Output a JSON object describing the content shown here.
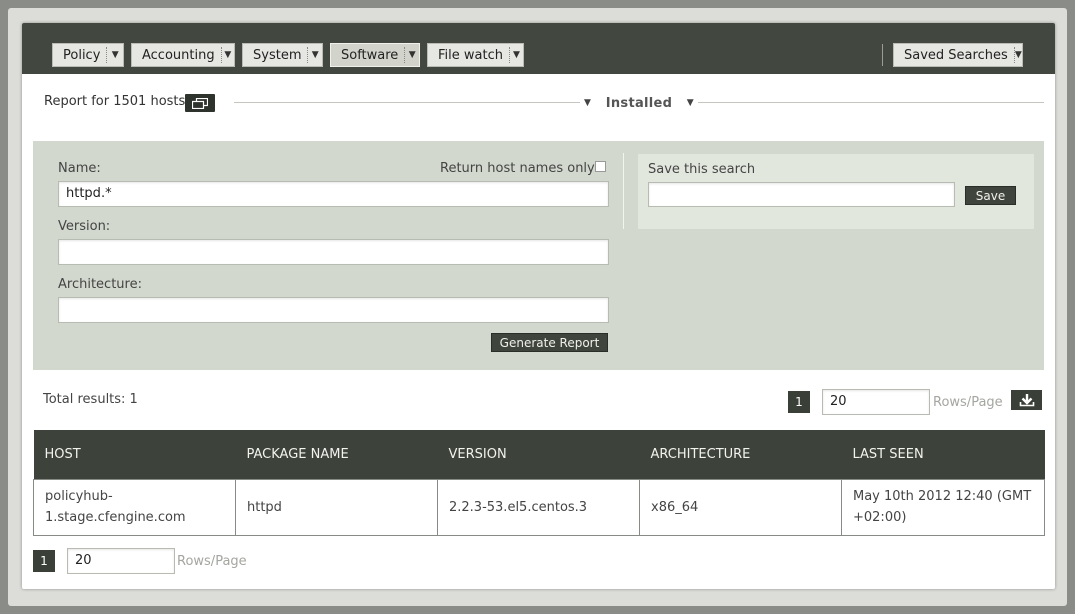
{
  "nav": {
    "menus": [
      {
        "label": "Policy"
      },
      {
        "label": "Accounting"
      },
      {
        "label": "System"
      },
      {
        "label": "Software"
      },
      {
        "label": "File watch"
      }
    ],
    "saved_searches": "Saved Searches"
  },
  "report": {
    "title": "Report for 1501 hosts",
    "view": "Installed"
  },
  "filter": {
    "name_label": "Name:",
    "name_value": "httpd.*",
    "return_hosts_label": "Return host names only:",
    "version_label": "Version:",
    "version_value": "",
    "arch_label": "Architecture:",
    "arch_value": "",
    "generate_label": "Generate Report",
    "save_search_label": "Save this search",
    "save_search_value": "",
    "save_label": "Save"
  },
  "results": {
    "total": "Total results: 1",
    "page": "1",
    "rows_per_page": "20",
    "rows_label": "Rows/Page"
  },
  "table": {
    "headers": [
      "HOST",
      "PACKAGE NAME",
      "VERSION",
      "ARCHITECTURE",
      "LAST SEEN"
    ],
    "rows": [
      [
        "policyhub-1.stage.cfengine.com",
        "httpd",
        "2.2.3-53.el5.centos.3",
        "x86_64",
        "May 10th 2012 12:40 (GMT +02:00)"
      ]
    ]
  },
  "icons": {
    "dropdown": "chevron-down-icon",
    "new_window": "window-icon",
    "download": "download-icon"
  },
  "colors": {
    "topbar": "#424840",
    "filter_panel": "#d2d8cd",
    "header_row": "#3d423a",
    "button_dark": "#3f453d"
  }
}
